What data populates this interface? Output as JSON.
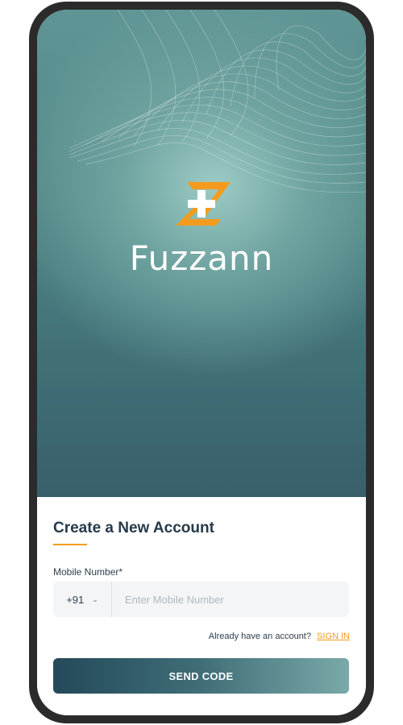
{
  "brand": {
    "name": "Fuzzann",
    "logo_icon": "fuzzann-z-plus-logo-icon",
    "accent_color": "#f49b1e"
  },
  "form": {
    "title": "Create a New Account",
    "mobile_label": "Mobile Number*",
    "country_code": "+91",
    "country_code_icon": "chevron-down-icon",
    "mobile_placeholder": "Enter Mobile Number",
    "mobile_value": "",
    "signin_prompt": "Already have an account?",
    "signin_link": "SIGN IN",
    "submit_label": "SEND CODE"
  },
  "colors": {
    "primary_dark": "#24495a",
    "title_text": "#263a4a"
  }
}
